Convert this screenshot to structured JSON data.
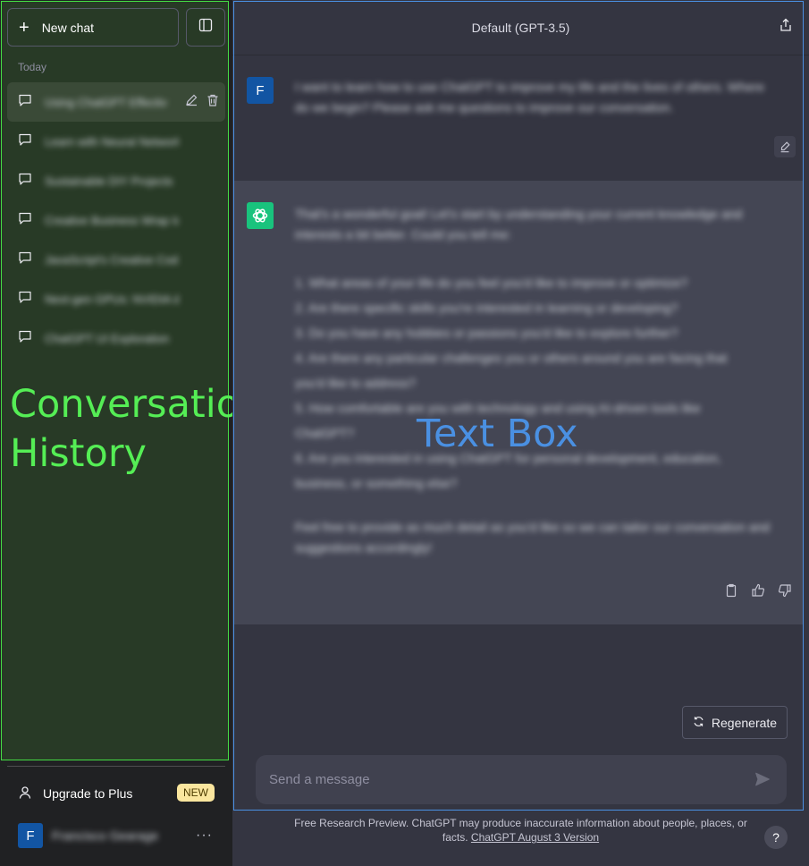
{
  "sidebar": {
    "new_chat_label": "New chat",
    "section_label": "Today",
    "items": [
      {
        "title": "Using ChatGPT Effectiv"
      },
      {
        "title": "Learn with Neural Networks"
      },
      {
        "title": "Sustainable DIY Projects"
      },
      {
        "title": "Creative Business Wrap Ideas"
      },
      {
        "title": "JavaScript's Creative Coding"
      },
      {
        "title": "Next-gen GPUs: NVIDIA & AMD"
      },
      {
        "title": "ChatGPT UI Exploration"
      }
    ],
    "upgrade_label": "Upgrade to Plus",
    "upgrade_badge": "NEW",
    "user": {
      "initial": "F",
      "name": "Francisco Gearage"
    },
    "overlay_label": "Conversation\nHistory"
  },
  "header": {
    "title": "Default (GPT-3.5)"
  },
  "messages": {
    "user": {
      "initial": "F",
      "text": "I want to learn how to use ChatGPT to improve my life and the lives of others. Where do we begin? Please ask me questions to improve our conversation."
    },
    "assistant": {
      "intro": "That's a wonderful goal! Let's start by understanding your current knowledge and interests a bit better. Could you tell me:",
      "items": [
        "1. What areas of your life do you feel you'd like to improve or optimize?",
        "2. Are there specific skills you're interested in learning or developing?",
        "3. Do you have any hobbies or passions you'd like to explore further?",
        "4. Are there any particular challenges you or others around you are facing that",
        "   you'd like to address?",
        "5. How comfortable are you with technology and using AI-driven tools like",
        "   ChatGPT?",
        "6. Are you interested in using ChatGPT for personal development, education,",
        "   business, or something else?"
      ],
      "outro": "Feel free to provide as much detail as you'd like so we can tailor our conversation and suggestions accordingly!"
    },
    "overlay_label": "Text Box"
  },
  "composer": {
    "regenerate_label": "Regenerate",
    "placeholder": "Send a message"
  },
  "footer": {
    "text": "Free Research Preview. ChatGPT may produce inaccurate information about people, places, or facts.",
    "link_label": "ChatGPT August 3 Version",
    "help_label": "?"
  },
  "colors": {
    "sidebar_bg": "#202123",
    "main_bg": "#343541",
    "assistant_bg": "#444654",
    "accent_green": "#19c37d",
    "badge_bg": "#fae69e",
    "overlay_green": "#55ee55",
    "overlay_blue": "#4a90e2"
  }
}
